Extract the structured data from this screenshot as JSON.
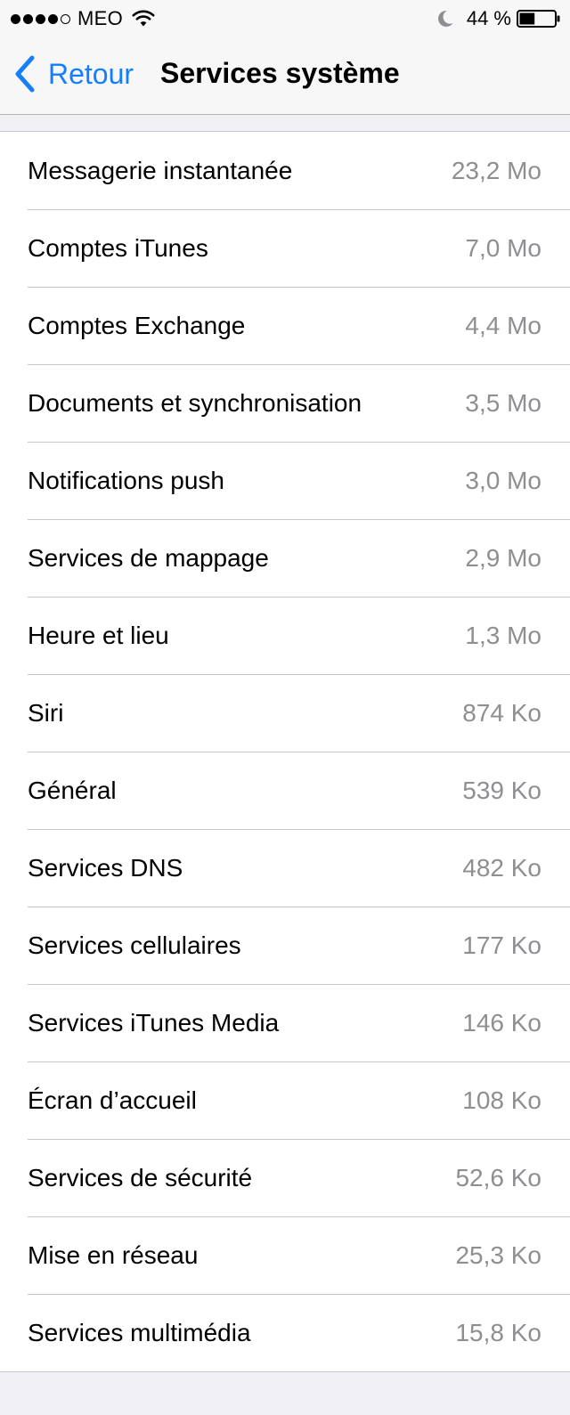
{
  "status_bar": {
    "signal_bars": 4,
    "signal_max": 5,
    "carrier": "MEO",
    "wifi_icon": "wifi-icon",
    "do_not_disturb_icon": "moon-icon",
    "battery_percent_label": "44 %",
    "battery_level": 0.44
  },
  "nav": {
    "back_label": "Retour",
    "title": "Services système",
    "accent_color": "#157efb"
  },
  "items": [
    {
      "label": "Messagerie instantanée",
      "value": "23,2 Mo"
    },
    {
      "label": "Comptes iTunes",
      "value": "7,0 Mo"
    },
    {
      "label": "Comptes Exchange",
      "value": "4,4 Mo"
    },
    {
      "label": "Documents et synchronisation",
      "value": "3,5 Mo"
    },
    {
      "label": "Notifications push",
      "value": "3,0 Mo"
    },
    {
      "label": "Services de mappage",
      "value": "2,9 Mo"
    },
    {
      "label": "Heure et lieu",
      "value": "1,3 Mo"
    },
    {
      "label": "Siri",
      "value": "874 Ko"
    },
    {
      "label": "Général",
      "value": "539 Ko"
    },
    {
      "label": "Services DNS",
      "value": "482 Ko"
    },
    {
      "label": "Services cellulaires",
      "value": "177 Ko"
    },
    {
      "label": "Services iTunes Media",
      "value": "146 Ko"
    },
    {
      "label": "Écran d’accueil",
      "value": "108 Ko"
    },
    {
      "label": "Services de sécurité",
      "value": "52,6 Ko"
    },
    {
      "label": "Mise en réseau",
      "value": "25,3 Ko"
    },
    {
      "label": "Services multimédia",
      "value": "15,8 Ko"
    }
  ]
}
